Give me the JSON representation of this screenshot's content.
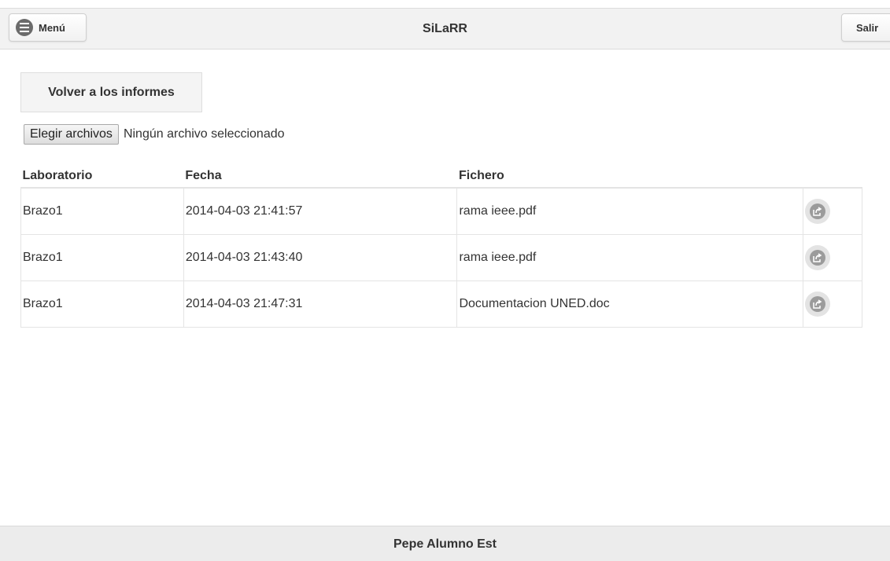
{
  "header": {
    "title": "SiLaRR",
    "menu_label": "Menú",
    "logout_label": "Salir"
  },
  "main": {
    "back_button_label": "Volver a los informes",
    "file_input": {
      "button_label": "Elegir archivos",
      "status": "Ningún archivo seleccionado"
    },
    "table": {
      "columns": [
        "Laboratorio",
        "Fecha",
        "Fichero",
        ""
      ],
      "rows": [
        {
          "laboratorio": "Brazo1",
          "fecha": "2014-04-03 21:41:57",
          "fichero": "rama ieee.pdf"
        },
        {
          "laboratorio": "Brazo1",
          "fecha": "2014-04-03 21:43:40",
          "fichero": "rama ieee.pdf"
        },
        {
          "laboratorio": "Brazo1",
          "fecha": "2014-04-03 21:47:31",
          "fichero": "Documentacion UNED.doc"
        }
      ]
    }
  },
  "footer": {
    "user_name": "Pepe Alumno Est"
  },
  "icons": {
    "menu": "menu-circle-icon",
    "share": "share-icon"
  }
}
